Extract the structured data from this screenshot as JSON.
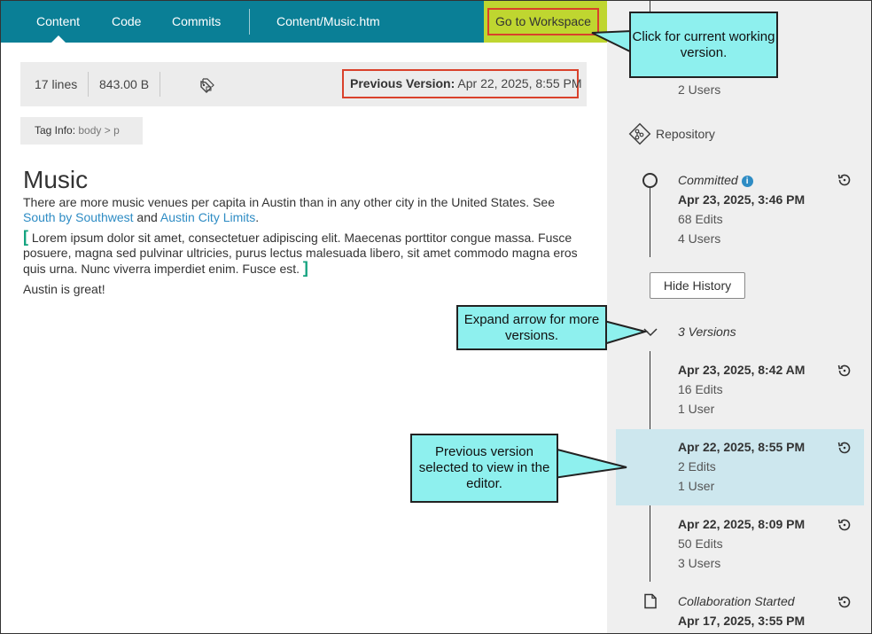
{
  "tabs": {
    "content": "Content",
    "code": "Code",
    "commits": "Commits",
    "file": "Content/Music.htm"
  },
  "workspace_button": "Go to Workspace",
  "infobar": {
    "lines": "17 lines",
    "size": "843.00 B",
    "previous_label": "Previous Version:",
    "previous_date": "Apr 22, 2025, 8:55 PM"
  },
  "taginfo": {
    "label": "Tag Info:",
    "path": "body > p"
  },
  "document": {
    "heading": "Music",
    "para1_before": "There are more music venues per capita in Austin than in any other city in the United States. See ",
    "link1": "South by Southwest",
    "para1_mid": " and ",
    "link2": "Austin City Limits",
    "para1_end": ".",
    "para2": " Lorem ipsum dolor sit amet, consectetuer adipiscing elit. Maecenas porttitor congue massa. Fusce posuere, magna sed pulvinar ultricies, purus lectus malesuada libero, sit amet commodo magna eros quis urna. Nunc viverra imperdiet enim. Fusce est. ",
    "para3": "Austin is great!"
  },
  "sidebar": {
    "top_users": "2 Users",
    "repository": "Repository",
    "committed": {
      "label": "Committed",
      "date": "Apr 23, 2025, 3:46 PM",
      "edits": "68 Edits",
      "users": "4 Users"
    },
    "hide_history": "Hide History",
    "versions_label": "3 Versions",
    "versions": [
      {
        "date": "Apr 23, 2025, 8:42 AM",
        "edits": "16 Edits",
        "users": "1 User"
      },
      {
        "date": "Apr 22, 2025, 8:55 PM",
        "edits": "2 Edits",
        "users": "1 User"
      },
      {
        "date": "Apr 22, 2025, 8:09 PM",
        "edits": "50 Edits",
        "users": "3 Users"
      }
    ],
    "collab": {
      "label": "Collaboration Started",
      "date": "Apr 17, 2025, 3:55 PM"
    }
  },
  "callouts": {
    "workspace": "Click for current working version.",
    "expand": "Expand arrow for more versions.",
    "previous": "Previous version selected to view in the editor."
  },
  "colors": {
    "topbar": "#0a7f96",
    "workspace_bg": "#bfd630",
    "highlight_border": "#d9412b",
    "callout": "#8ef0ee",
    "selected_row": "#cde7ee",
    "link": "#2e8cc4"
  }
}
